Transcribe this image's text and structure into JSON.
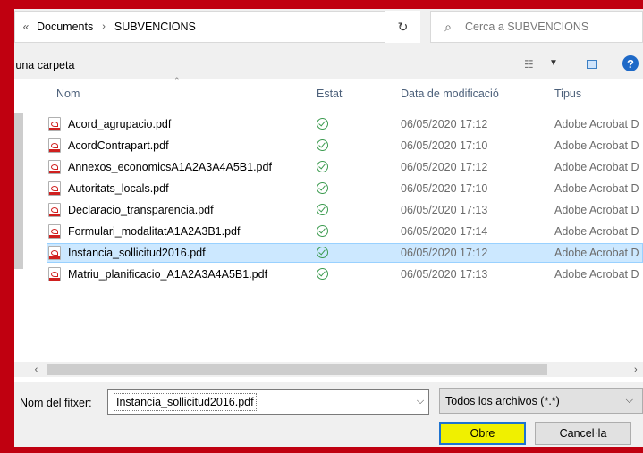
{
  "address": {
    "prev": "«",
    "segments": [
      "Documents",
      "SUBVENCIONS"
    ],
    "separator": "›",
    "dropdown": "⌵"
  },
  "refresh": "↻",
  "search": {
    "placeholder": "Cerca a SUBVENCIONS",
    "icon": "search-icon"
  },
  "toolbar": {
    "new_folder": "ea una carpeta",
    "view_icon": "☷",
    "view_dd": "▼",
    "help": "?"
  },
  "columns": {
    "name": "Nom",
    "status": "Estat",
    "date": "Data de modificació",
    "type": "Tipus"
  },
  "files": [
    {
      "name": "Acord_agrupacio.pdf",
      "date": "06/05/2020 17:12",
      "type": "Adobe Acrobat D",
      "selected": false
    },
    {
      "name": "AcordContrapart.pdf",
      "date": "06/05/2020 17:10",
      "type": "Adobe Acrobat D",
      "selected": false
    },
    {
      "name": "Annexos_economicsA1A2A3A4A5B1.pdf",
      "date": "06/05/2020 17:12",
      "type": "Adobe Acrobat D",
      "selected": false
    },
    {
      "name": "Autoritats_locals.pdf",
      "date": "06/05/2020 17:10",
      "type": "Adobe Acrobat D",
      "selected": false
    },
    {
      "name": "Declaracio_transparencia.pdf",
      "date": "06/05/2020 17:13",
      "type": "Adobe Acrobat D",
      "selected": false
    },
    {
      "name": "Formulari_modalitatA1A2A3B1.pdf",
      "date": "06/05/2020 17:14",
      "type": "Adobe Acrobat D",
      "selected": false
    },
    {
      "name": "Instancia_sollicitud2016.pdf",
      "date": "06/05/2020 17:12",
      "type": "Adobe Acrobat D",
      "selected": true
    },
    {
      "name": "Matriu_planificacio_A1A2A3A4A5B1.pdf",
      "date": "06/05/2020 17:13",
      "type": "Adobe Acrobat D",
      "selected": false
    }
  ],
  "filename": {
    "label": "Nom del fitxer:",
    "value": "Instancia_sollicitud2016.pdf"
  },
  "filter": {
    "value": "Todos los archivos (*.*)"
  },
  "buttons": {
    "open": "Obre",
    "cancel": "Cancel·la"
  },
  "colors": {
    "accent_red": "#c00010",
    "selection": "#cce8ff",
    "open_button": "#f0f000"
  }
}
